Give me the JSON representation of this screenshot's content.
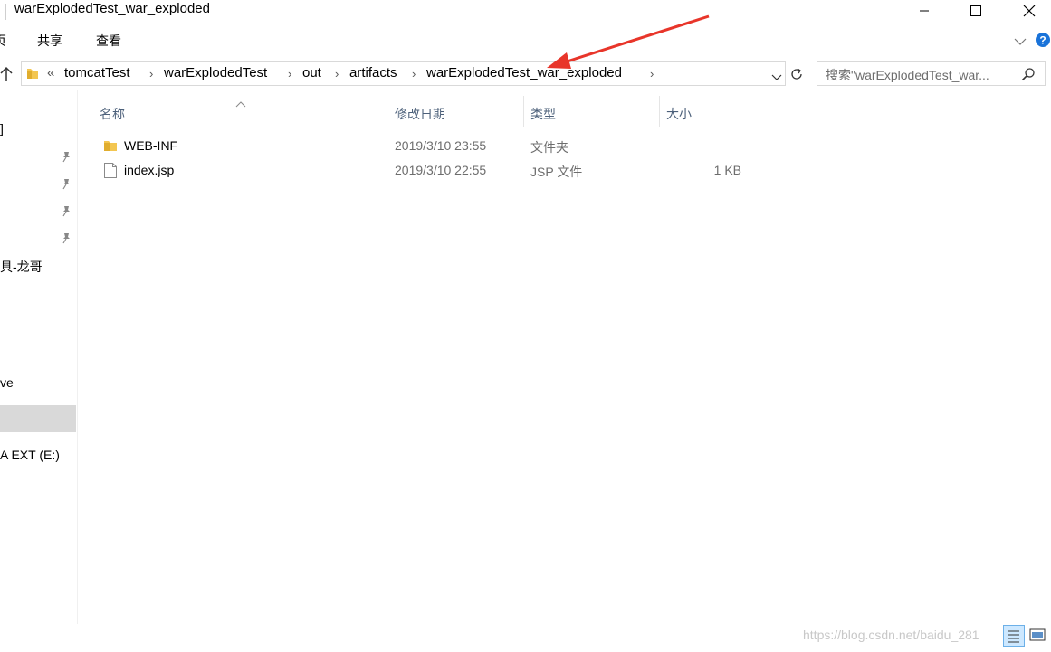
{
  "window": {
    "title": "warExplodedTest_war_exploded"
  },
  "ribbon": {
    "tabs": [
      "页",
      "共享",
      "查看"
    ]
  },
  "address": {
    "overflow": "«",
    "breadcrumbs": [
      "tomcatTest",
      "warExplodedTest",
      "out",
      "artifacts",
      "warExplodedTest_war_exploded"
    ]
  },
  "search": {
    "placeholder": "搜索\"warExplodedTest_war..."
  },
  "nav": {
    "items": [
      "]",
      "具-龙哥",
      "ve",
      "A EXT (E:)"
    ]
  },
  "columns": {
    "name": "名称",
    "modified": "修改日期",
    "type": "类型",
    "size": "大小"
  },
  "files": [
    {
      "name": "WEB-INF",
      "modified": "2019/3/10 23:55",
      "type": "文件夹",
      "size": "",
      "icon": "folder-icon"
    },
    {
      "name": "index.jsp",
      "modified": "2019/3/10 22:55",
      "type": "JSP 文件",
      "size": "1 KB",
      "icon": "file-icon"
    }
  ],
  "watermark": "https://blog.csdn.net/baidu_281",
  "colors": {
    "annotation_arrow": "#e8352a",
    "header_text": "#4c607a",
    "folder": "#f3c651"
  }
}
